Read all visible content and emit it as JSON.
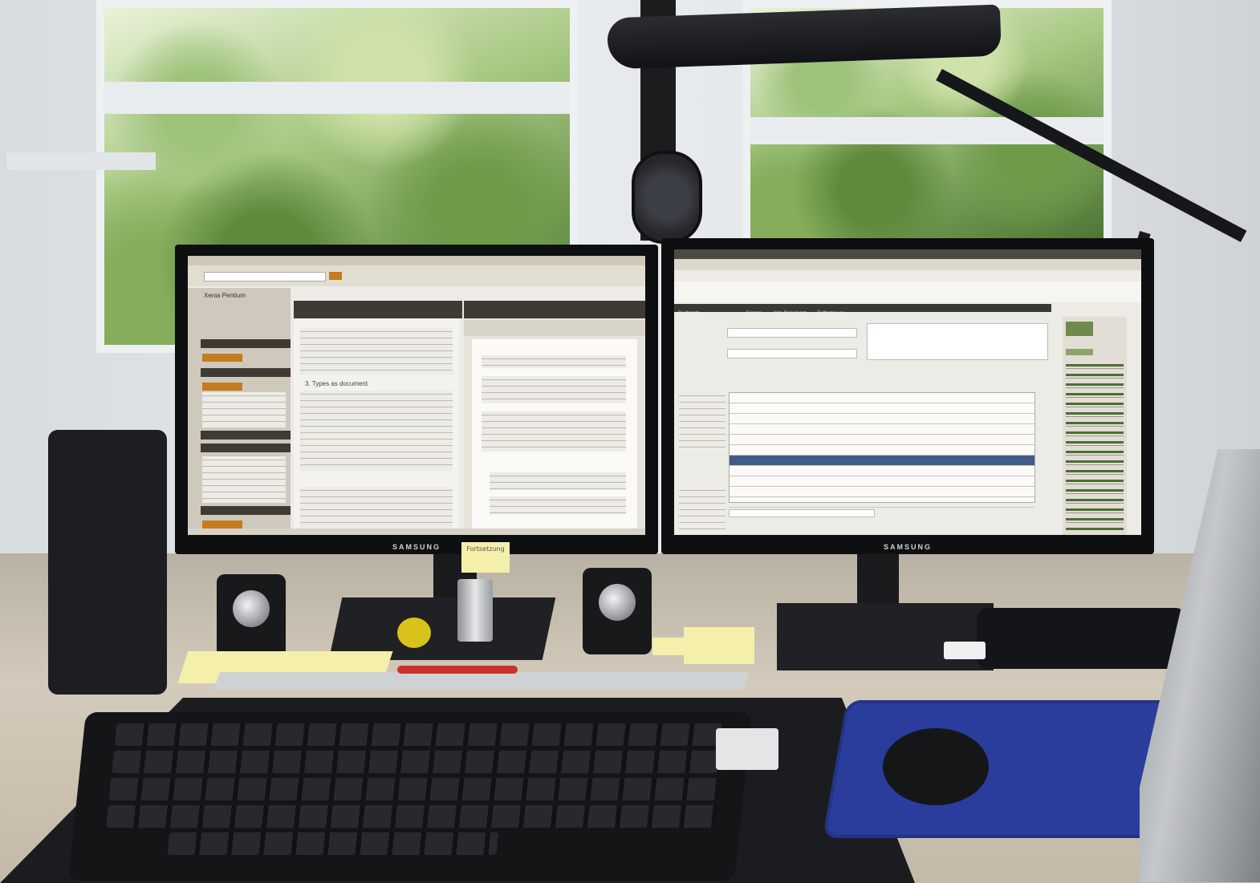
{
  "monitors": {
    "left": {
      "brand": "SAMSUNG",
      "title_bar": "",
      "panel_title": "Xenia Pentium",
      "orange_buttons": [
        "",
        "",
        ""
      ],
      "section_heading": "3. Types as document",
      "footer_left": "",
      "footer_right": ""
    },
    "right": {
      "brand": "SAMSUNG",
      "title_bar": "",
      "nav_tabs": [
        "Suchende",
        "",
        "",
        "",
        "Fragen",
        "Akte Dokument",
        "Fallbetreuer"
      ],
      "list_rows": [
        {
          "label": "",
          "value": ""
        },
        {
          "label": "",
          "value": ""
        },
        {
          "label": "",
          "value": ""
        },
        {
          "label": "",
          "value": ""
        },
        {
          "label": "",
          "value": ""
        },
        {
          "label": "",
          "value": ""
        },
        {
          "label": "",
          "value": ""
        },
        {
          "label": "",
          "value": ""
        },
        {
          "label": "",
          "value": ""
        },
        {
          "label": "",
          "value": ""
        },
        {
          "label": "",
          "value": ""
        }
      ]
    }
  },
  "sticky_note_text": "Fortsetzung",
  "colors": {
    "left_panel_dark": "#3f3a34",
    "accent_orange": "#c57b1f",
    "selected_row": "#415a88",
    "mousepad": "#2a3d9c"
  }
}
